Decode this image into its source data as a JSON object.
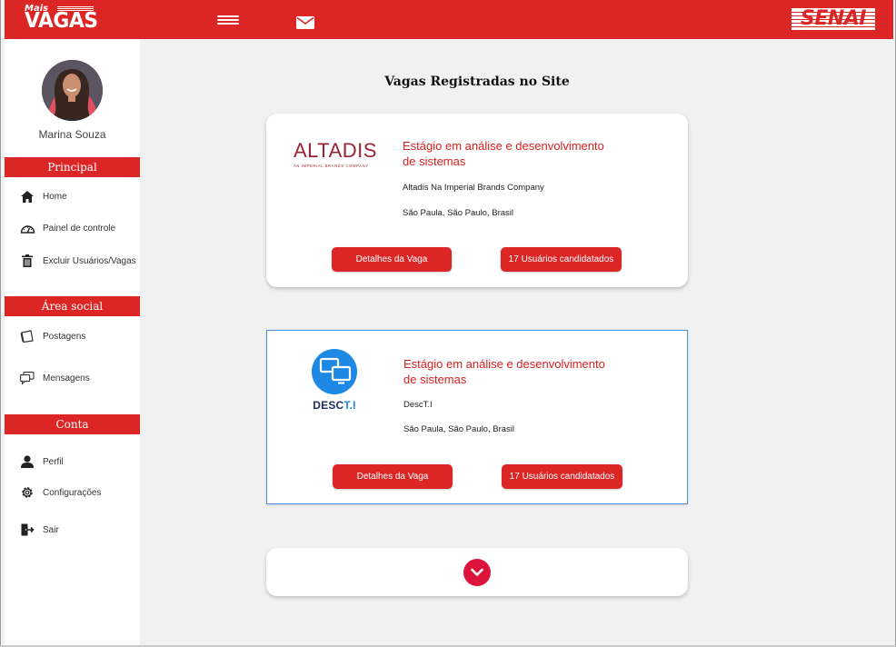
{
  "header": {
    "logo_top": "Mais",
    "logo_main": "VAGAS",
    "brand": "SENAI",
    "menu_icon": "hamburger-icon",
    "mail_icon": "mail-icon"
  },
  "sidebar": {
    "user_name": "Marina Souza",
    "sections": [
      {
        "title": "Principal",
        "items": [
          {
            "label": "Home",
            "icon": "home-icon"
          },
          {
            "label": "Painel de controle",
            "icon": "gauge-icon"
          },
          {
            "label": "Excluir Usuários/Vagas",
            "icon": "trash-icon"
          }
        ]
      },
      {
        "title": "Área social",
        "items": [
          {
            "label": "Postagens",
            "icon": "posts-icon"
          },
          {
            "label": "Mensagens",
            "icon": "chat-icon"
          }
        ]
      },
      {
        "title": "Conta",
        "items": [
          {
            "label": "Perfil",
            "icon": "user-icon"
          },
          {
            "label": "Configurações",
            "icon": "settings-icon"
          },
          {
            "label": "Sair",
            "icon": "logout-icon"
          }
        ]
      }
    ]
  },
  "main": {
    "title": "Vagas Registradas no Site",
    "jobs": [
      {
        "logo_text": "ALTADIS",
        "logo_subtext": "AN IMPERIAL BRANDS COMPANY",
        "title": "Estágio em análise e desenvolvimento de sistemas",
        "company": "Altadis Na Imperial Brands Company",
        "location": "São Paula, São Paulo, Brasil",
        "details_label": "Detalhes da Vaga",
        "candidates_label": "17 Usuários candidatados"
      },
      {
        "logo_text_a": "DESC",
        "logo_text_b": "T.I",
        "title": "Estágio em análise e desenvolvimento de sistemas",
        "company": "DescT.I",
        "location": "São Paula, São Paulo, Brasil",
        "details_label": "Detalhes da Vaga",
        "candidates_label": "17 Usuários candidatados"
      }
    ],
    "load_more_icon": "chevron-down-icon"
  },
  "colors": {
    "brand_red": "#dc2626",
    "job_title_red": "#d71f1f",
    "load_more_red": "#dc143c",
    "desc_blue": "#1e88e5",
    "altadis_red": "#9b2335"
  }
}
